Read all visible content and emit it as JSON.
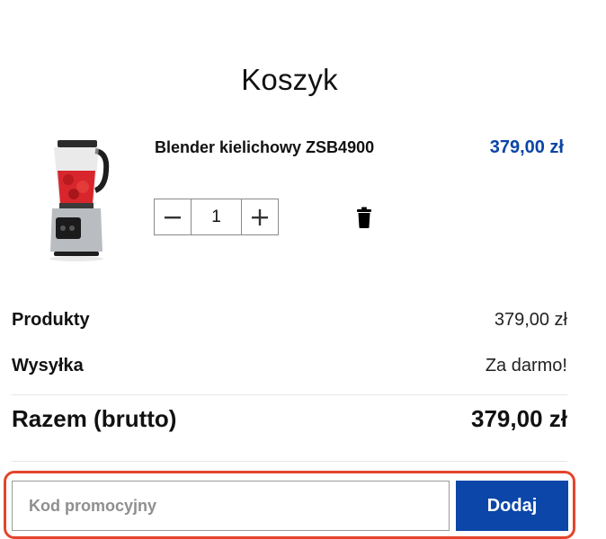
{
  "page": {
    "title": "Koszyk"
  },
  "cart": {
    "items": [
      {
        "name": "Blender kielichowy ZSB4900",
        "price": "379,00 zł",
        "quantity": "1",
        "image_icon": "blender-product-image"
      }
    ]
  },
  "controls": {
    "decrease_icon": "minus-icon",
    "increase_icon": "plus-icon",
    "remove_icon": "trash-icon"
  },
  "summary": {
    "products_label": "Produkty",
    "products_value": "379,00 zł",
    "shipping_label": "Wysyłka",
    "shipping_value": "Za darmo!",
    "total_label": "Razem (brutto)",
    "total_value": "379,00 zł"
  },
  "promo": {
    "placeholder": "Kod promocyjny",
    "value": "",
    "button_label": "Dodaj"
  },
  "colors": {
    "accent": "#0b46a8",
    "price": "#0a45a6",
    "highlight": "#e3452b"
  }
}
